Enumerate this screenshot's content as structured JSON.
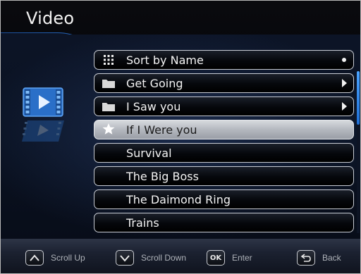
{
  "header": {
    "title": "Video"
  },
  "menu": {
    "items": [
      {
        "label": "Sort by Name",
        "left_icon": "grid-icon",
        "right_icon": "dot-icon",
        "selected": false
      },
      {
        "label": "Get Going",
        "left_icon": "folder-icon",
        "right_icon": "arrow-right-icon",
        "selected": false
      },
      {
        "label": "I Saw you",
        "left_icon": "folder-icon",
        "right_icon": "arrow-right-icon",
        "selected": false
      },
      {
        "label": "If I Were you",
        "left_icon": "star-icon",
        "right_icon": "",
        "selected": true
      },
      {
        "label": "Survival",
        "left_icon": "",
        "right_icon": "",
        "selected": false
      },
      {
        "label": "The Big Boss",
        "left_icon": "",
        "right_icon": "",
        "selected": false
      },
      {
        "label": "The Daimond Ring",
        "left_icon": "",
        "right_icon": "",
        "selected": false
      },
      {
        "label": "Trains",
        "left_icon": "",
        "right_icon": "",
        "selected": false
      }
    ]
  },
  "footer": {
    "scroll_up": {
      "label": "Scroll Up",
      "icon": "chevron-up-icon"
    },
    "scroll_down": {
      "label": "Scroll Down",
      "icon": "chevron-down-icon"
    },
    "enter": {
      "label": "Enter",
      "key_text": "OK"
    },
    "back": {
      "label": "Back",
      "icon": "back-arrow-icon"
    }
  },
  "colors": {
    "accent": "#2f7fe0",
    "selected_bg": "#b4b8bf",
    "panel_bg": "#0c1426"
  }
}
